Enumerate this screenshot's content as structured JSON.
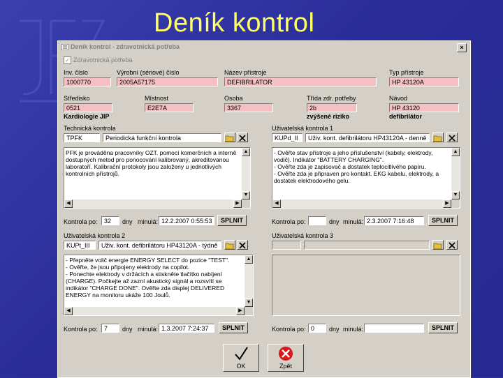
{
  "slide": {
    "title": "Deník kontrol"
  },
  "dialog": {
    "title": "Deník kontrol - zdravotnická potřeba",
    "close": "×",
    "checkbox_label": "Zdravotnická potřeba",
    "checkbox_mark": "✓",
    "fields": {
      "inv_label": "Inv. číslo",
      "inv_value": "1000770",
      "serial_label": "Výrobní (sériové) číslo",
      "serial_value": "2005A57175",
      "name_label": "Název přístroje",
      "name_value": "DEFIBRILATOR",
      "type_label": "Typ přístroje",
      "type_value": "HP 43120A",
      "center_label": "Středisko",
      "center_value": "0521",
      "center_name": "Kardiologie JIP",
      "room_label": "Místnost",
      "room_value": "E2E7A",
      "person_label": "Osoba",
      "person_value": "3367",
      "class_label": "Třída zdr. potřeby",
      "class_value": "2b",
      "class_name": "zvýšené riziko",
      "manual_label": "Návod",
      "manual_value": "HP 43120",
      "manual_name": "defibrilátor"
    },
    "panels": [
      {
        "label": "Technická kontrola",
        "code": "TPFK",
        "desc": "Periodická funkční kontrola",
        "text": "PFK je prováděna pracovníky OZT. pomocí komerčních a interně dostupných metod pro ponocování kalibrovaný, akreditovanou laboratoří. Kalibrační protokoly jsou založeny u jednotlivých kontrolních přístrojů.",
        "interval_label": "Kontrola po:",
        "interval": "32",
        "unit": "dny",
        "last_label": "minulá:",
        "last": "12.2.2007 0:55:53",
        "button": "SPLNIT"
      },
      {
        "label": "Uživatelská kontrola 1",
        "code": "KUPd_II",
        "desc": "Uživ. kont. defibrilátoru HP43120A - denně",
        "text": "- Ověřte stav přístroje a jeho příslušenství (kabely, elektrody, vodič). Indikátor \"BATTERY CHARGING\".\n- Ověřte zda je zapisovač a dostatek teplocitlivého papíru.\n- Ověřte zda je připraven pro kontakt. EKG kabelu, elektrody, a dostatek elektrodového gelu.",
        "interval_label": "Kontrola po:",
        "interval": "",
        "unit": "dny",
        "last_label": "minulá:",
        "last": "2.3.2007 7:16:48",
        "button": "SPLNIT"
      },
      {
        "label": "Uživatelská kontrola 2",
        "code": "KUPt_III",
        "desc": "Uživ. kont. defibrilátoru HP43120A - týdně",
        "text": "- Přepněte volič energie ENERGY SELECT do pozice \"TEST\".\n- Ověřte, že jsou připojeny elektrody na copilot.\n- Ponechte elektrody v držácích a stiskněte tlačítko nabíjení (CHARGE). Počkejte až zazní akustický signál a rozsvítí se indikátor \"CHARGE DONE\". Ověřte zda displej DELIVERED ENERGY na monitoru ukáže 100 Joulů.",
        "interval_label": "Kontrola po:",
        "interval": "7",
        "unit": "dny",
        "last_label": "minulá:",
        "last": "1.3.2007 7:24:37",
        "button": "SPLNIT"
      },
      {
        "label": "Uživatelská kontrola 3",
        "code": "",
        "desc": "",
        "text": "",
        "interval_label": "Kontrola po:",
        "interval": "0",
        "unit": "dny",
        "last_label": "minulá:",
        "last": "",
        "button": "SPLNIT"
      }
    ],
    "ok_label": "OK",
    "back_label": "Zpět"
  },
  "colors": {
    "background": "#2b2f9c",
    "title": "#ffff66",
    "field": "#f4c0c4",
    "dialog": "#d4d0c8"
  }
}
